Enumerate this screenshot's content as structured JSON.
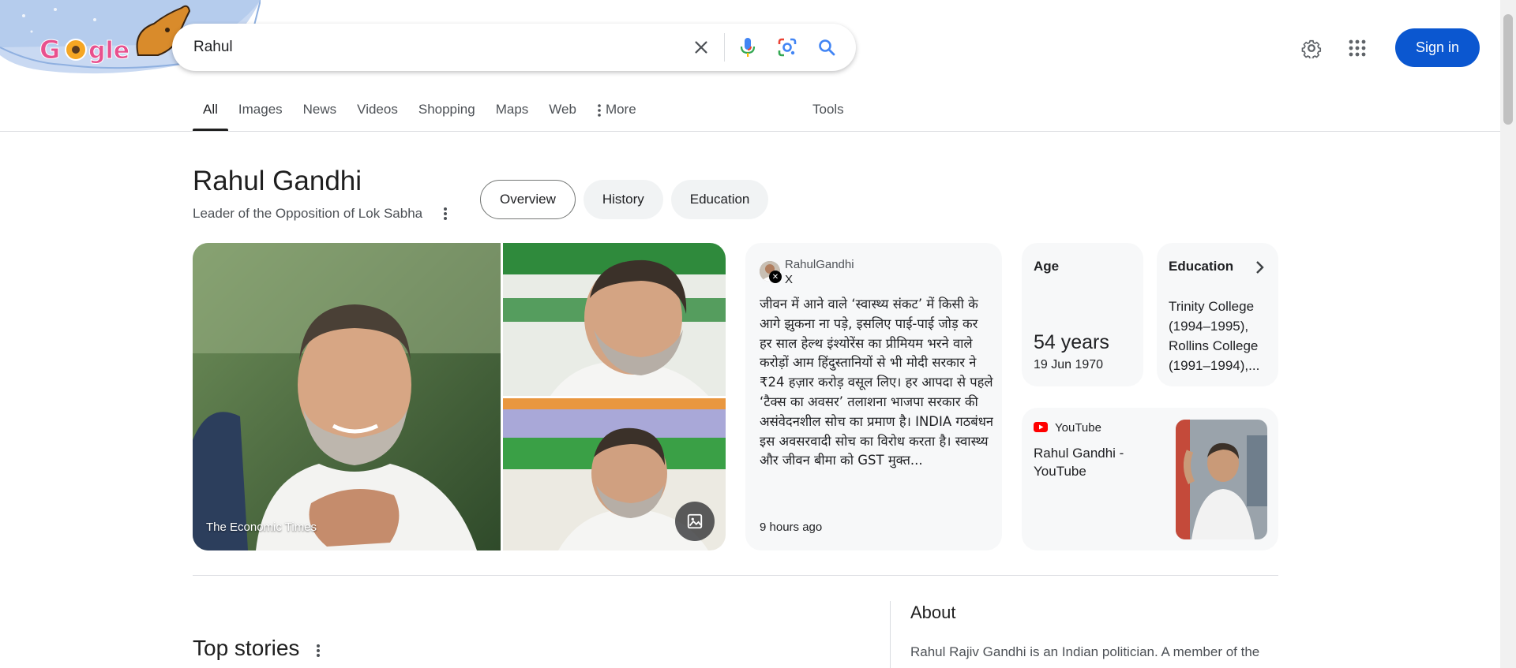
{
  "search": {
    "query": "Rahul",
    "logo_text": "Google"
  },
  "header": {
    "signin_label": "Sign in"
  },
  "tabs": [
    {
      "label": "All"
    },
    {
      "label": "Images"
    },
    {
      "label": "News"
    },
    {
      "label": "Videos"
    },
    {
      "label": "Shopping"
    },
    {
      "label": "Maps"
    },
    {
      "label": "Web"
    },
    {
      "label": "More"
    }
  ],
  "tools_label": "Tools",
  "knowledge_panel": {
    "title": "Rahul Gandhi",
    "subtitle": "Leader of the Opposition of Lok Sabha",
    "chips": [
      "Overview",
      "History",
      "Education"
    ],
    "image_source": "The Economic Times",
    "tweet": {
      "user": "RahulGandhi",
      "network": "X",
      "text": "जीवन में आने वाले ‘स्वास्थ्य संकट’ में किसी के आगे झुकना ना पड़े, इसलिए पाई-पाई जोड़ कर हर साल हेल्थ इंश्योरेंस का प्रीमियम भरने वाले करोड़ों आम हिंदुस्तानियों से भी मोदी सरकार ने ₹24 हज़ार करोड़ वसूल लिए। हर आपदा से पहले ‘टैक्स का अवसर’ तलाशना भाजपा सरकार की असंवेदनशील सोच का प्रमाण है। INDIA गठबंधन इस अवसरवादी सोच का विरोध करता है। स्वास्थ्य और जीवन बीमा को GST मुक्त...",
      "time": "9 hours ago"
    },
    "age": {
      "label": "Age",
      "value": "54 years",
      "date": "19 Jun 1970"
    },
    "education": {
      "label": "Education",
      "value": "Trinity College (1994–1995), Rollins College (1991–1994),..."
    },
    "youtube": {
      "source": "YouTube",
      "title": "Rahul Gandhi - YouTube"
    }
  },
  "top_stories_label": "Top stories",
  "about": {
    "heading": "About",
    "text": "Rahul Rajiv Gandhi is an Indian politician. A member of the"
  },
  "colors": {
    "accent": "#0b57d0",
    "youtube_red": "#ff0000",
    "card_bg": "#f7f8f9"
  }
}
